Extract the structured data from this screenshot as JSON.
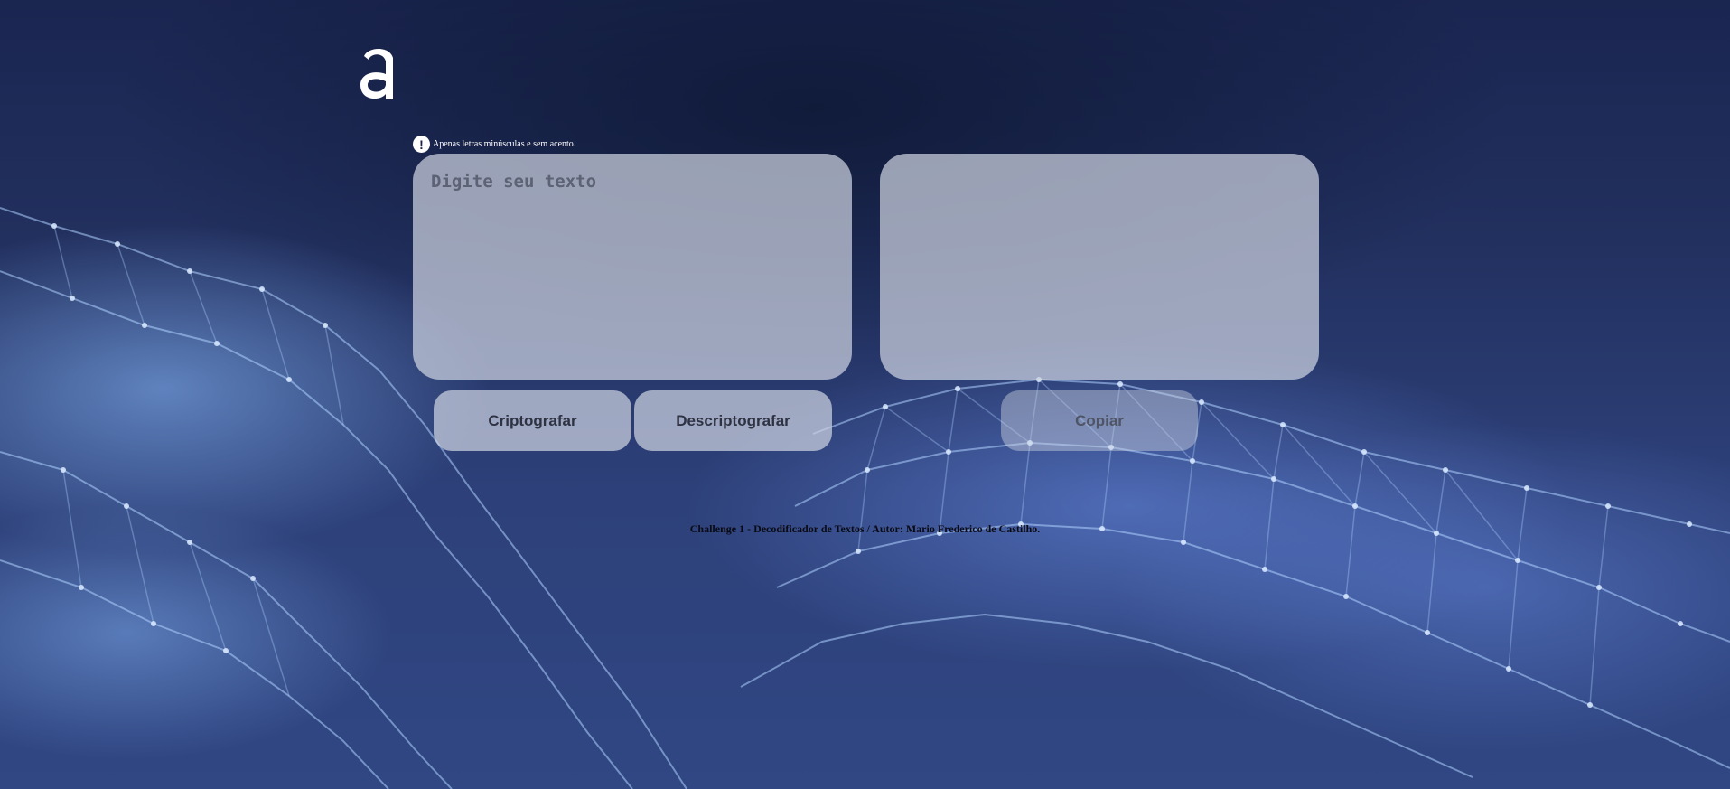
{
  "brand": {
    "logo_icon": "alura-a-logo-icon"
  },
  "hint": {
    "icon": "exclamation-circle-icon",
    "text": "Apenas letras minúsculas e sem acento."
  },
  "input": {
    "placeholder": "Digite seu texto",
    "value": ""
  },
  "output": {
    "value": ""
  },
  "buttons": {
    "encrypt_label": "Criptografar",
    "decrypt_label": "Descriptografar",
    "copy_label": "Copiar"
  },
  "footer": {
    "text": "Challenge 1 - Decodificador de Textos / Autor: Mario Frederico de Castilho."
  },
  "colors": {
    "panel": "#cdd2e0",
    "text_dark": "#2e3242",
    "background_top": "#1a2550",
    "background_bottom": "#304784",
    "glow": "#8cbeff"
  }
}
